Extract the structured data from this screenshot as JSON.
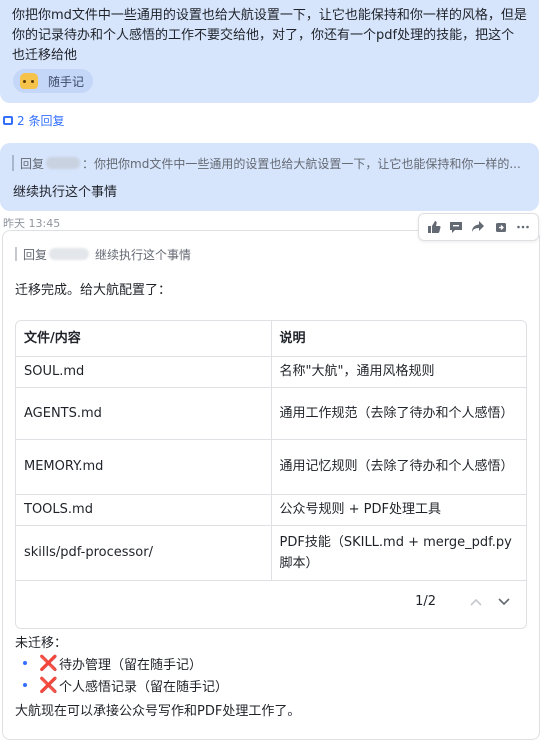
{
  "top_message": {
    "text": "你把你md文件中一些通用的设置也给大航设置一下，让它也能保持和你一样的风格，但是你的记录待办和个人感悟的工作不要交给他，对了，你还有一个pdf处理的技能，把这个也迁移给他",
    "chip_label": "随手记",
    "chip_icon": "emoji-face-icon"
  },
  "reply_count": "2 条回复",
  "second_message": {
    "quote_prefix": "回复",
    "quote_suffix": "：你把你md文件中一些通用的设置也给大航设置一下，让它也能保持和你一样的...",
    "text": "继续执行这个事情"
  },
  "timestamp": "昨天 13:45",
  "toolbar": {
    "icons": [
      "thumbs-up-icon",
      "comment-icon",
      "share-icon",
      "forward-icon",
      "more-icon"
    ]
  },
  "reply": {
    "quote_prefix": "回复",
    "quote_text": "继续执行这个事情",
    "intro": "迁移完成。给大航配置了：",
    "table": {
      "headers": [
        "文件/内容",
        "说明"
      ],
      "rows": [
        [
          "SOUL.md",
          "名称\"大航\"，通用风格规则"
        ],
        [
          "AGENTS.md",
          "通用工作规范（去除了待办和个人感悟）"
        ],
        [
          "MEMORY.md",
          "通用记忆规则（去除了待办和个人感悟）"
        ],
        [
          "TOOLS.md",
          "公众号规则 + PDF处理工具"
        ],
        [
          "skills/pdf-processor/",
          "PDF技能（SKILL.md + merge_pdf.py 脚本）"
        ]
      ],
      "page": "1/2"
    },
    "unmoved_label": "未迁移：",
    "unmoved_items": [
      "待办管理（留在随手记）",
      "个人感悟记录（留在随手记）"
    ],
    "cross_glyph": "❌",
    "closing": "大航现在可以承接公众号写作和PDF处理工作了。"
  },
  "colors": {
    "bubble": "#d6e4fc",
    "link": "#3370ff",
    "cross": "#e0245e"
  }
}
